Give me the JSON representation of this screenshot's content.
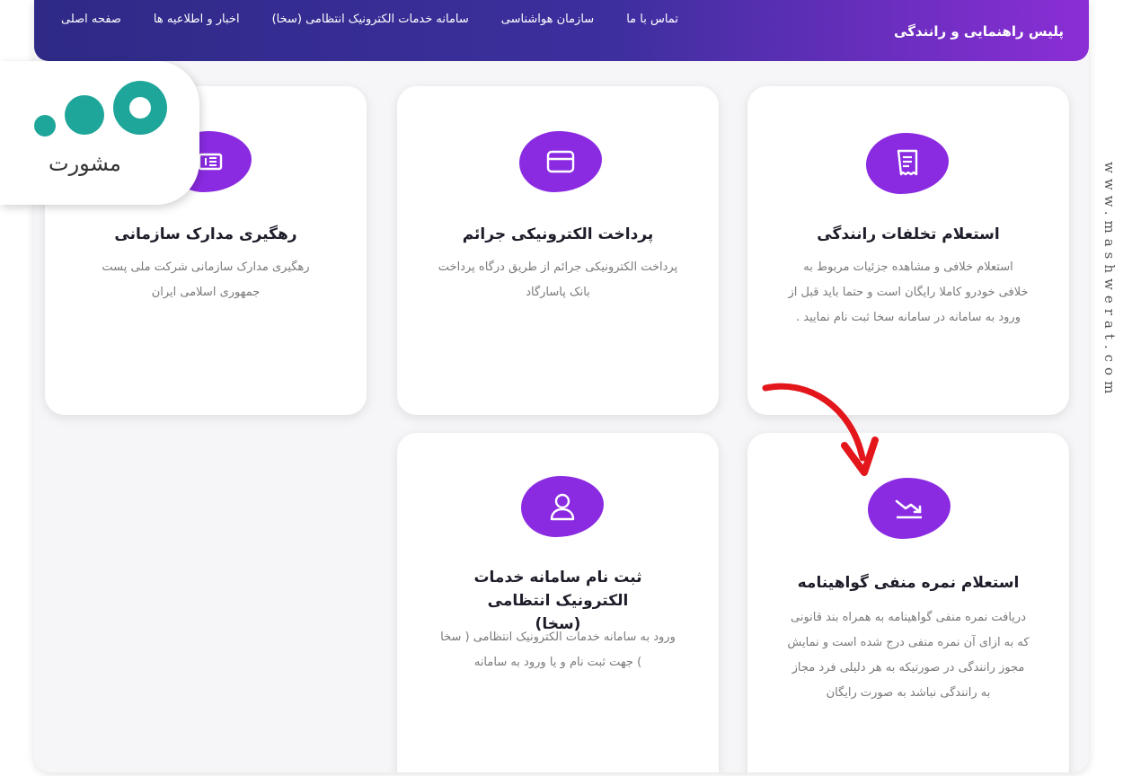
{
  "navbar": {
    "brand": "پلیس راهنمایی و رانندگی",
    "items": [
      {
        "label": "صفحه اصلی"
      },
      {
        "label": "اخبار و اطلاعیه ها"
      },
      {
        "label": "سامانه خدمات الکترونیک انتظامی (سخا)"
      },
      {
        "label": "سازمان هواشناسی"
      },
      {
        "label": "تماس با ما"
      }
    ]
  },
  "cards": [
    {
      "title": "استعلام تخلفات رانندگی",
      "description": "استعلام خلافی و مشاهده جزئیات مربوط به خلافی خودرو کاملا رایگان است و حتما باید قبل از ورود به سامانه در سامانه سخا ثبت نام نمایید .",
      "icon": "receipt-icon"
    },
    {
      "title": "پرداخت الکترونیکی جرائم",
      "description": "پرداخت الکترونیکی جرائم از طریق درگاه پرداخت بانک پاسارگاد",
      "icon": "credit-card-icon"
    },
    {
      "title": "رهگیری مدارک سازمانی",
      "description": "رهگیری مدارک سازمانی شرکت ملی پست جمهوری اسلامی ایران",
      "icon": "document-track-icon"
    },
    {
      "title": "استعلام نمره منفی گواهینامه",
      "description": "دریافت نمره منفی گواهینامه به همراه بند قانونی که به ازای آن نمره منفی درج شده است و نمایش مجوز رانندگی در صورتیکه به هر دلیلی فرد مجاز به رانندگی نباشد به صورت رایگان",
      "icon": "trend-down-icon"
    },
    {
      "title": "ثبت نام سامانه خدمات الکترونیک انتظامی (سخا)",
      "description": "ورود به سامانه خدمات الکترونیک انتظامی ( سخا ) جهت ثبت نام و یا ورود به سامانه",
      "icon": "user-icon"
    }
  ],
  "logo": {
    "text": "مشورت"
  },
  "watermark": "www.mashwerat.com",
  "colors": {
    "accent": "#8a2be2",
    "nav_start": "#2e2a86",
    "nav_end": "#8b2ed6",
    "logo_teal": "#1fa69a",
    "arrow": "#e3161b"
  }
}
